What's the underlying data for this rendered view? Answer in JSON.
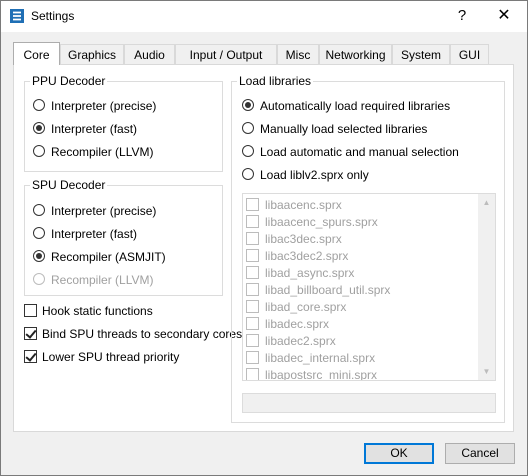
{
  "window": {
    "title": "Settings",
    "help_symbol": "?",
    "close_symbol": "✕",
    "icon": "rpcs3-icon"
  },
  "tabs": [
    "Core",
    "Graphics",
    "Audio",
    "Input / Output",
    "Misc",
    "Networking",
    "System",
    "GUI"
  ],
  "active_tab": "Core",
  "ppu_decoder": {
    "title": "PPU Decoder",
    "options": [
      "Interpreter (precise)",
      "Interpreter (fast)",
      "Recompiler (LLVM)"
    ],
    "selected": "Interpreter (fast)"
  },
  "spu_decoder": {
    "title": "SPU Decoder",
    "options": [
      "Interpreter (precise)",
      "Interpreter (fast)",
      "Recompiler (ASMJIT)",
      "Recompiler (LLVM)"
    ],
    "selected": "Recompiler (ASMJIT)",
    "disabled": [
      "Recompiler (LLVM)"
    ]
  },
  "checkboxes": [
    {
      "label": "Hook static functions",
      "checked": false
    },
    {
      "label": "Bind SPU threads to secondary cores",
      "checked": true
    },
    {
      "label": "Lower SPU thread priority",
      "checked": true
    }
  ],
  "load_libraries": {
    "title": "Load libraries",
    "options": [
      "Automatically load required libraries",
      "Manually load selected libraries",
      "Load automatic and manual selection",
      "Load liblv2.sprx only"
    ],
    "selected": "Automatically load required libraries",
    "library_list": [
      "libaacenc.sprx",
      "libaacenc_spurs.sprx",
      "libac3dec.sprx",
      "libac3dec2.sprx",
      "libad_async.sprx",
      "libad_billboard_util.sprx",
      "libad_core.sprx",
      "libadec.sprx",
      "libadec2.sprx",
      "libadec_internal.sprx",
      "libapostsrc_mini.sprx"
    ],
    "filter_value": ""
  },
  "buttons": {
    "ok": "OK",
    "cancel": "Cancel"
  }
}
